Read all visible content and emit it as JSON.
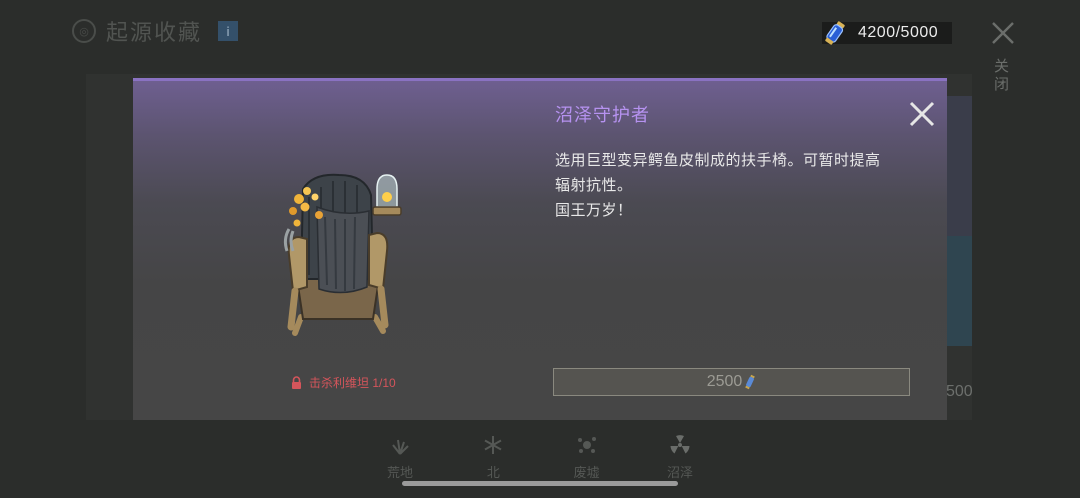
{
  "background": {
    "title": "起源收藏",
    "info_label": "i",
    "currency": "4200/5000",
    "close_label": "关闭",
    "side_value": "500",
    "tabs": [
      {
        "label": "荒地",
        "icon": "grass-icon"
      },
      {
        "label": "北",
        "icon": "snowflake-icon"
      },
      {
        "label": "废墟",
        "icon": "debris-icon"
      },
      {
        "label": "沼泽",
        "icon": "radiation-icon"
      }
    ]
  },
  "modal": {
    "name": "沼泽守护者",
    "description": [
      "选用巨型变异鳄鱼皮制成的扶手椅。可暂时提高",
      "辐射抗性。",
      "国王万岁！"
    ],
    "unlock_requirement": "击杀利维坦 1/10",
    "price": "2500",
    "close_icon": "close-icon"
  },
  "colors": {
    "accent_purple": "#b692f0",
    "locked_red": "#d4555b",
    "modal_top_border": "#8a72c2"
  }
}
